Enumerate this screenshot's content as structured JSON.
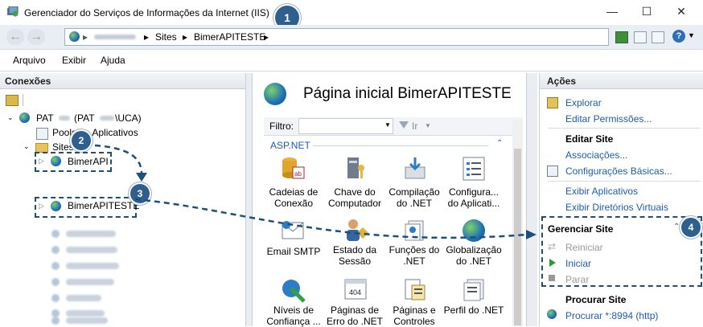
{
  "window": {
    "title": "Gerenciador do Serviços de Informações da Internet (IIS)",
    "controls": {
      "minimize": "—",
      "maximize": "☐",
      "close": "✕"
    }
  },
  "callouts": [
    "1",
    "2",
    "3",
    "4"
  ],
  "address": {
    "segments": [
      "Sites",
      "BimerAPITESTE"
    ],
    "separator": "▸",
    "blurred_server": "PAT"
  },
  "menu": [
    "Arquivo",
    "Exibir",
    "Ajuda"
  ],
  "left": {
    "header": "Conexões",
    "server": {
      "prefix": "PAT",
      "middle": "(PAT",
      "suffix": "\\UCA)"
    },
    "pools": "Pools de Aplicativos",
    "sites": "Sites",
    "site1": "BimerAPI",
    "site2": "BimerAPITESTE",
    "blurred_rows": 8
  },
  "middle": {
    "title": "Página inicial BimerAPITESTE",
    "filter_label": "Filtro:",
    "go_label": "Ir",
    "group": "ASP.NET",
    "features": [
      [
        "Cadeias de",
        "Conexão"
      ],
      [
        "Chave do",
        "Computador"
      ],
      [
        "Compilação",
        "do .NET"
      ],
      [
        "Configura...",
        "do Aplicati..."
      ],
      [
        "Email SMTP",
        ""
      ],
      [
        "Estado da",
        "Sessão"
      ],
      [
        "Funções do",
        ".NET"
      ],
      [
        "Globalização",
        "do .NET"
      ],
      [
        "Níveis de",
        "Confiança ..."
      ],
      [
        "Páginas de",
        "Erro do .NET"
      ],
      [
        "Páginas e",
        "Controles"
      ],
      [
        "Perfil do .NET",
        ""
      ]
    ]
  },
  "right": {
    "header": "Ações",
    "explore": "Explorar",
    "edit_perms": "Editar Permissões...",
    "edit_site": "Editar Site",
    "bindings": "Associações...",
    "basic": "Configurações Básicas...",
    "view_apps": "Exibir Aplicativos",
    "view_vdirs": "Exibir Diretórios Virtuais",
    "manage": "Gerenciar Site",
    "restart": "Reiniciar",
    "start": "Iniciar",
    "stop": "Parar",
    "browse": "Procurar Site",
    "browse_link": "Procurar *:8994 (http)"
  },
  "colors": {
    "accent_link": "#1f5bb0",
    "callout": "#2f5f8d",
    "dashed": "#1c4f7a"
  }
}
